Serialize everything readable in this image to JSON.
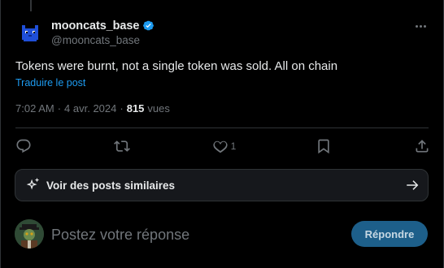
{
  "author": {
    "display_name": "mooncats_base",
    "handle": "@mooncats_base",
    "verified": true
  },
  "tweet": {
    "text": "Tokens were burnt, not a single token was sold. All on chain",
    "translate_label": "Traduire le post"
  },
  "meta": {
    "time": "7:02 AM",
    "date": "4 avr. 2024",
    "views_count": "815",
    "views_label": "vues"
  },
  "actions": {
    "reply_count": "",
    "retweet_count": "",
    "like_count": "1",
    "bookmark_count": ""
  },
  "similar": {
    "label": "Voir des posts similaires"
  },
  "reply": {
    "placeholder": "Postez votre réponse",
    "button_label": "Répondre"
  },
  "colors": {
    "background": "#000000",
    "accent": "#1d9bf0",
    "secondary_text": "#71767b",
    "reply_button": "#1d5f8a"
  },
  "icons": [
    "verified-badge-icon",
    "more-icon",
    "reply-icon",
    "retweet-icon",
    "like-icon",
    "bookmark-icon",
    "share-icon",
    "sparkle-icon",
    "arrow-right-icon"
  ]
}
